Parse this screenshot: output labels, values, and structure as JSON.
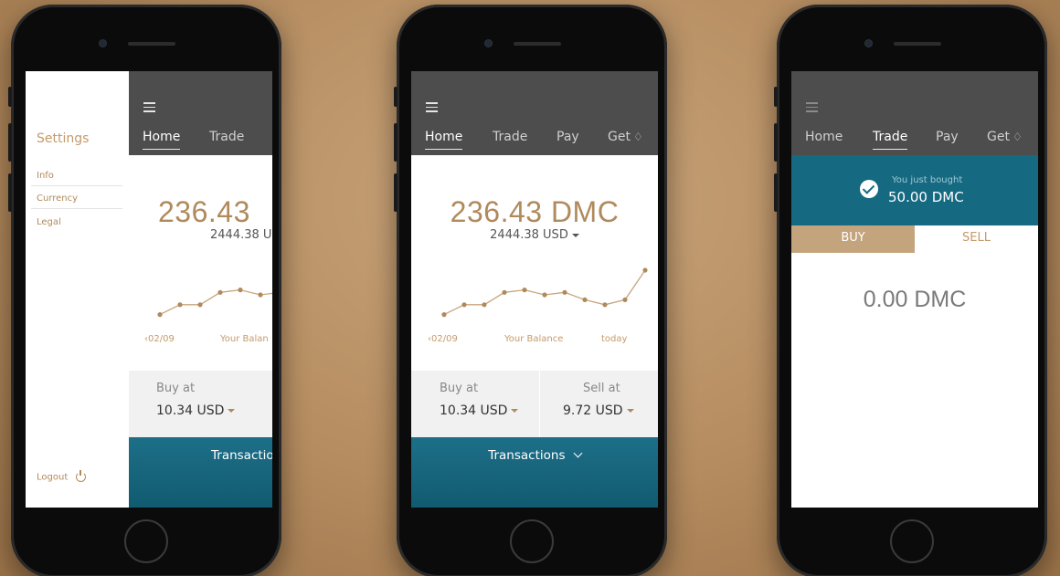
{
  "colors": {
    "gold": "#b08a5c",
    "teal": "#156a82",
    "header": "#4d4d4d"
  },
  "tabs": {
    "home": "Home",
    "trade": "Trade",
    "pay": "Pay",
    "get": "Get"
  },
  "drawer": {
    "title": "Settings",
    "items": [
      "Info",
      "Currency",
      "Legal"
    ],
    "logout": "Logout"
  },
  "home": {
    "balance_full": "236.43 DMC",
    "balance_clipped": "236.43",
    "usd_full": "2444.38 USD",
    "usd_clipped": "2444.38 U",
    "chart_labels": {
      "start": "02/09",
      "center": "Your Balance",
      "center_clipped": "Your Balan",
      "end": "today"
    },
    "buy_label": "Buy at",
    "buy_value": "10.34 USD",
    "sell_label": "Sell at",
    "sell_value": "9.72 USD",
    "transactions": "Transactions",
    "transactions_clipped": "Transactio"
  },
  "chart_data": {
    "type": "line",
    "values": [
      0.1,
      0.3,
      0.3,
      0.55,
      0.6,
      0.5,
      0.55,
      0.4,
      0.3,
      0.4,
      1.0
    ]
  },
  "trade": {
    "bought_label": "You just bought",
    "bought_value": "50.00 DMC",
    "buy_tab": "BUY",
    "sell_tab": "SELL",
    "amount": "0.00 DMC"
  },
  "icons": [
    "hamburger-icon",
    "diamond-icon",
    "caret-down-icon",
    "chevron-left-icon",
    "chevron-down-icon",
    "power-icon",
    "check-icon"
  ]
}
